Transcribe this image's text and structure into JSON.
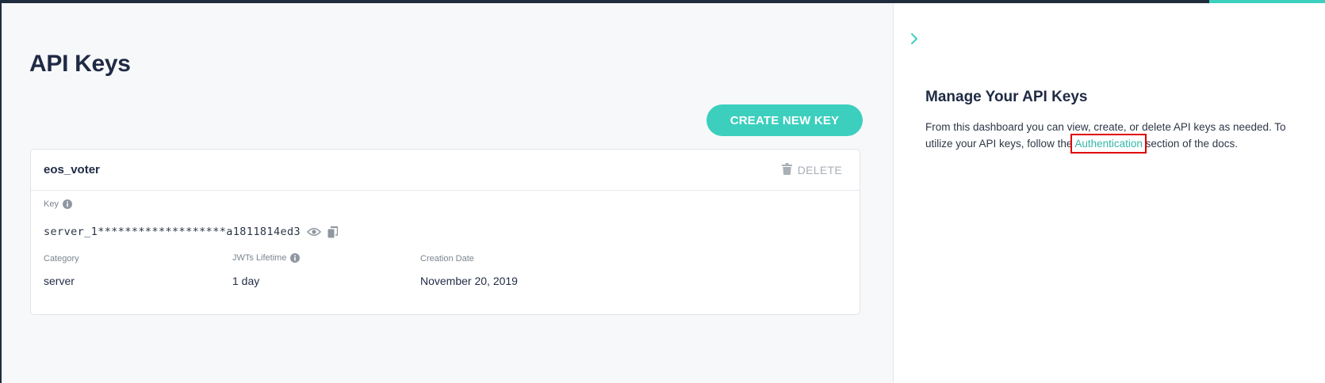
{
  "page": {
    "title": "API Keys",
    "create_button_label": "CREATE NEW KEY"
  },
  "api_key_card": {
    "name": "eos_voter",
    "delete_label": "DELETE",
    "key_label": "Key",
    "key_value": "server_1*******************a1811814ed3",
    "category_label": "Category",
    "category_value": "server",
    "jwt_label": "JWTs Lifetime",
    "jwt_value": "1 day",
    "creation_label": "Creation Date",
    "creation_value": "November 20, 2019"
  },
  "side_panel": {
    "title": "Manage Your API Keys",
    "text_before_link": "From this dashboard you can view, create, or delete API keys as needed. To utilize your API keys, follow the ",
    "link_text": "Authentication",
    "text_after_link": " section of the docs."
  },
  "colors": {
    "accent": "#3ccfbe",
    "link": "#35b8a9",
    "highlight_box": "#e00000",
    "top_bar": "#1f2d3d"
  },
  "icons": {
    "delete": "trash-icon",
    "info": "info-icon",
    "reveal": "eye-icon",
    "copy": "copy-icon",
    "collapse": "chevron-right-icon"
  }
}
